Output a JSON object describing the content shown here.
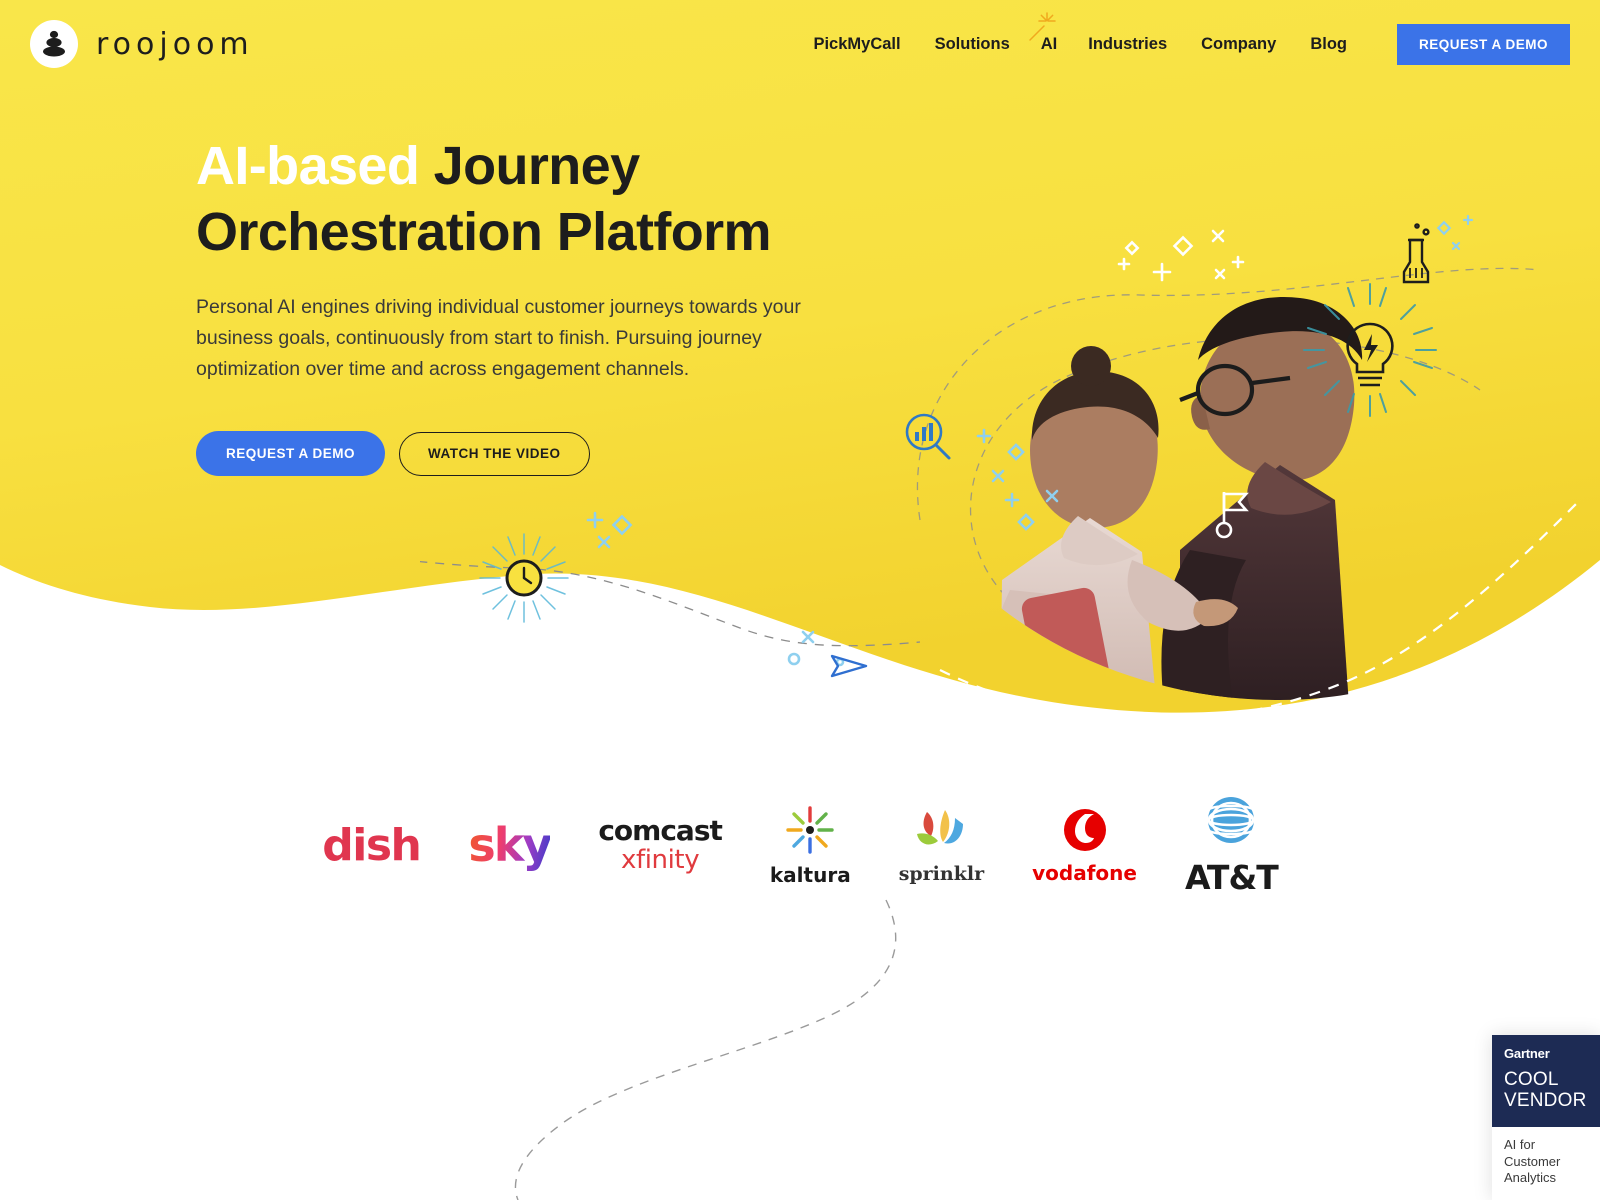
{
  "brand": {
    "name": "roojoom",
    "mark_icon": "stacked-stones-icon"
  },
  "nav": {
    "items": [
      {
        "label": "PickMyCall"
      },
      {
        "label": "Solutions"
      },
      {
        "label": "AI",
        "icon": "magic-wand-sparkle-icon"
      },
      {
        "label": "Industries"
      },
      {
        "label": "Company"
      },
      {
        "label": "Blog"
      }
    ],
    "cta": "REQUEST A DEMO"
  },
  "hero": {
    "title_highlight": "AI-based",
    "title_rest": " Journey",
    "title_line2": "Orchestration Platform",
    "subtitle": "Personal AI engines driving individual customer journeys towards your business goals, continuously from start to finish. Pursuing journey optimization over time and across engagement channels.",
    "primary_cta": "REQUEST A DEMO",
    "secondary_cta": "WATCH THE VIDEO",
    "art": {
      "photo_alt": "two people looking at a smartphone",
      "doodles": [
        "magnifier-chart-icon",
        "lightbulb-bolt-icon",
        "flag-icon",
        "beaker-icon",
        "clock-icon",
        "paper-plane-icon"
      ]
    }
  },
  "logos": [
    {
      "name": "dish",
      "label": "dish"
    },
    {
      "name": "sky",
      "label": "sky"
    },
    {
      "name": "comcast-xfinity",
      "label": "comcast",
      "label2": "xfinity"
    },
    {
      "name": "kaltura",
      "label": "kaltura"
    },
    {
      "name": "sprinklr",
      "label": "sprinklr"
    },
    {
      "name": "vodafone",
      "label": "vodafone"
    },
    {
      "name": "att",
      "label": "AT&T"
    }
  ],
  "gartner": {
    "brand": "Gartner",
    "title_line1": "COOL",
    "title_line2": "VENDOR",
    "subtitle": "AI for Customer Analytics"
  },
  "colors": {
    "brand_yellow": "#f8e13f",
    "accent_blue": "#3b73e8",
    "ink": "#1d1d1d",
    "gartner_navy": "#1d2b54"
  }
}
